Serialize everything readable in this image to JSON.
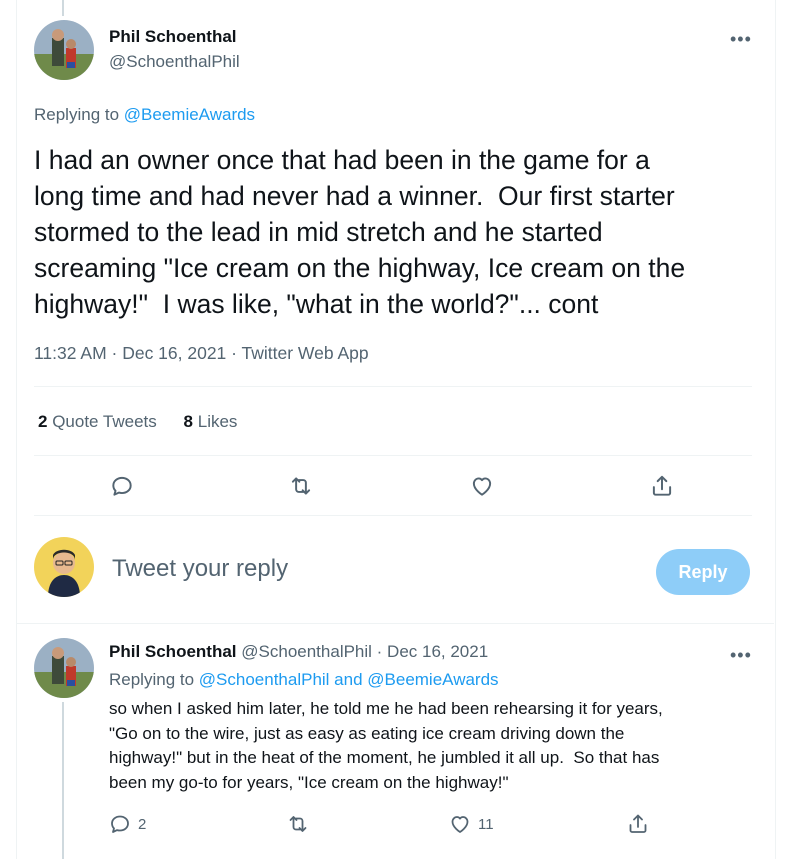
{
  "main_tweet": {
    "author_name": "Phil Schoenthal",
    "author_handle": "@SchoenthalPhil",
    "more_label": "•••",
    "replying_prefix": "Replying to ",
    "replying_to": "@BeemieAwards",
    "text": "I had an owner once that had been in the game for a\nlong time and had never had a winner.  Our first starter\nstormed to the lead in mid stretch and he started\nscreaming \"Ice cream on the highway, Ice cream on the\nhighway!\"  I was like, \"what in the world?\"... cont",
    "timestamp": "11:32 AM · Dec 16, 2021 · Twitter Web App",
    "quote_tweets_count": "2",
    "quote_tweets_label": "Quote Tweets",
    "likes_count": "8",
    "likes_label": "Likes",
    "actions": [
      "reply-icon",
      "retweet-icon",
      "like-icon",
      "share-icon"
    ]
  },
  "reply_box": {
    "placeholder": "Tweet your reply",
    "button_label": "Reply",
    "button_color": "#8ecdf8"
  },
  "reply_tweet": {
    "author_name": "Phil Schoenthal",
    "author_handle": "@SchoenthalPhil",
    "separator": " · ",
    "date": "Dec 16, 2021",
    "more_label": "•••",
    "replying_prefix": "Replying to ",
    "replying_to_1": "@SchoenthalPhil",
    "replying_and": " and ",
    "replying_to_2": "@BeemieAwards",
    "text": "so when I asked him later, he told me he had been rehearsing it for years,\n\"Go on to the wire, just as easy as eating ice cream driving down the\nhighway!\" but in the heat of the moment, he jumbled it all up.  So that has\nbeen my go-to for years, \"Ice cream on the highway!\"",
    "reply_count": "2",
    "retweet_count": "",
    "like_count": "11"
  },
  "colors": {
    "accent": "#1d9bf0",
    "secondary_text": "#536471",
    "text": "#0f1419"
  }
}
